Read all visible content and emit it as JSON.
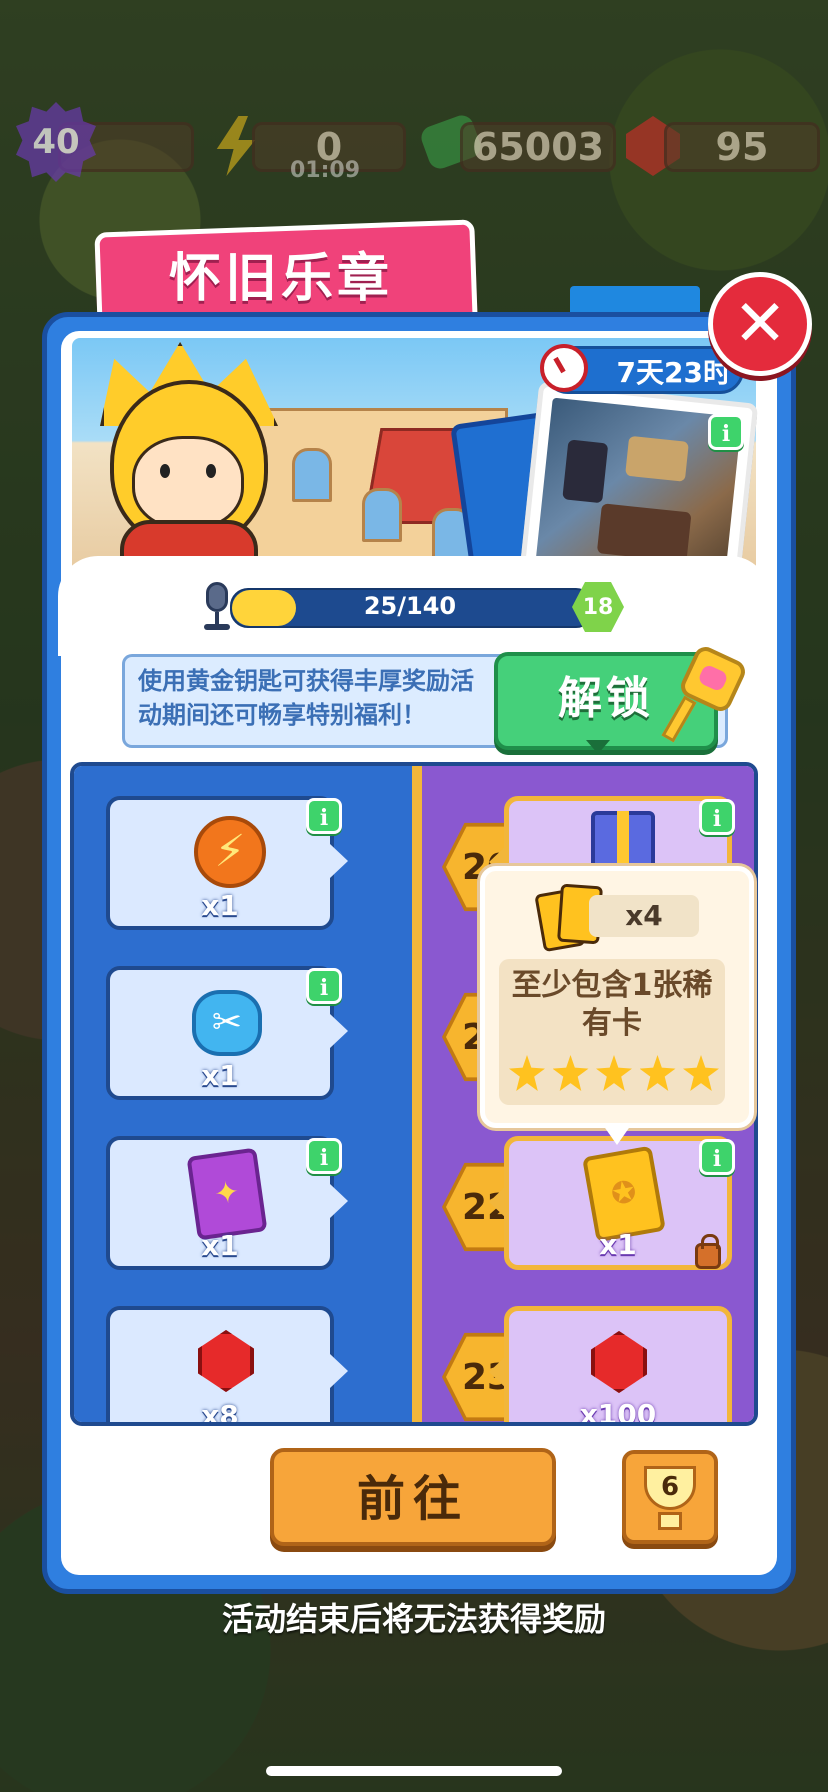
{
  "hud": {
    "level": "40",
    "energy": "0",
    "energy_timer": "01:09",
    "cash": "65003",
    "gems": "95"
  },
  "event": {
    "title": "怀旧乐章",
    "time_left": "7天23时"
  },
  "progress": {
    "text": "25/140",
    "value": 25,
    "max": 140,
    "level": "18"
  },
  "unlock": {
    "description": "使用黄金钥匙可获得丰厚奖励活动期间还可畅享特别福利！",
    "button_label": "解锁"
  },
  "rewards": [
    {
      "level": "20",
      "free_qty": "x1",
      "free_icon": "energy-coin-icon",
      "paid_qty": "",
      "paid_icon": "gift-box-icon"
    },
    {
      "level": "21",
      "free_qty": "x1",
      "free_icon": "scissors-icon",
      "paid_qty": "",
      "paid_icon": ""
    },
    {
      "level": "22",
      "free_qty": "x1",
      "free_icon": "purple-card-pack-icon",
      "paid_qty": "x1",
      "paid_icon": "gold-card-pack-icon"
    },
    {
      "level": "23",
      "free_qty": "x8",
      "free_icon": "ruby-icon",
      "paid_qty": "x100",
      "paid_icon": "ruby-icon"
    }
  ],
  "tooltip": {
    "qty": "x4",
    "description": "至少包含1张稀有卡",
    "stars": 5
  },
  "buttons": {
    "go_label": "前往",
    "trophy_count": "6"
  },
  "footer": "活动结束后将无法获得奖励",
  "colors": {
    "panel_blue": "#2f7fe0",
    "title_pink": "#f0427a",
    "unlock_green": "#45d07a",
    "go_orange": "#f7a53a",
    "premium_purple": "#8a58d0"
  }
}
